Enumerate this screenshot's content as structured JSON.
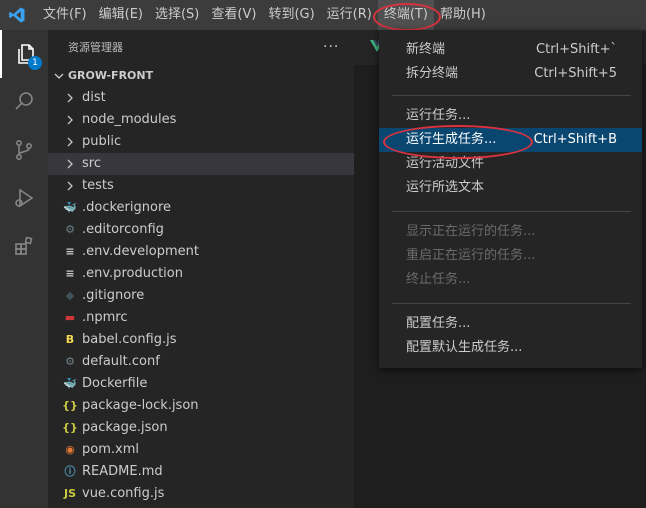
{
  "menubar": {
    "items": [
      {
        "label": "文件(F)"
      },
      {
        "label": "编辑(E)"
      },
      {
        "label": "选择(S)"
      },
      {
        "label": "查看(V)"
      },
      {
        "label": "转到(G)"
      },
      {
        "label": "运行(R)"
      },
      {
        "label": "终端(T)"
      },
      {
        "label": "帮助(H)"
      }
    ]
  },
  "activity": {
    "badge": "1"
  },
  "sidebar": {
    "title": "资源管理器",
    "more": "···",
    "section": "GROW-FRONT",
    "tree": [
      {
        "name": "dist",
        "kind": "folder"
      },
      {
        "name": "node_modules",
        "kind": "folder"
      },
      {
        "name": "public",
        "kind": "folder"
      },
      {
        "name": "src",
        "kind": "folder"
      },
      {
        "name": "tests",
        "kind": "folder"
      },
      {
        "name": ".dockerignore",
        "kind": "docker"
      },
      {
        "name": ".editorconfig",
        "kind": "gear"
      },
      {
        "name": ".env.development",
        "kind": "lines"
      },
      {
        "name": ".env.production",
        "kind": "lines"
      },
      {
        "name": ".gitignore",
        "kind": "git"
      },
      {
        "name": ".npmrc",
        "kind": "npm"
      },
      {
        "name": "babel.config.js",
        "kind": "babel"
      },
      {
        "name": "default.conf",
        "kind": "gear"
      },
      {
        "name": "Dockerfile",
        "kind": "docker"
      },
      {
        "name": "package-lock.json",
        "kind": "json"
      },
      {
        "name": "package.json",
        "kind": "json"
      },
      {
        "name": "pom.xml",
        "kind": "rss"
      },
      {
        "name": "README.md",
        "kind": "info"
      },
      {
        "name": "vue.config.js",
        "kind": "js"
      }
    ]
  },
  "terminal_menu": {
    "items": [
      {
        "label": "新终端",
        "shortcut": "Ctrl+Shift+`"
      },
      {
        "label": "拆分终端",
        "shortcut": "Ctrl+Shift+5"
      },
      {
        "label": "运行任务..."
      },
      {
        "label": "运行生成任务...",
        "shortcut": "Ctrl+Shift+B"
      },
      {
        "label": "运行活动文件"
      },
      {
        "label": "运行所选文本"
      },
      {
        "label": "显示正在运行的任务..."
      },
      {
        "label": "重启正在运行的任务..."
      },
      {
        "label": "终止任务..."
      },
      {
        "label": "配置任务..."
      },
      {
        "label": "配置默认生成任务..."
      }
    ]
  },
  "colors": {
    "titlebar": "#3c3c3c",
    "activitybar": "#333333",
    "sidebar": "#252526",
    "editor": "#1e1e1e",
    "accent": "#007acc",
    "highlight": "#094771",
    "annotation": "#d9333f"
  }
}
